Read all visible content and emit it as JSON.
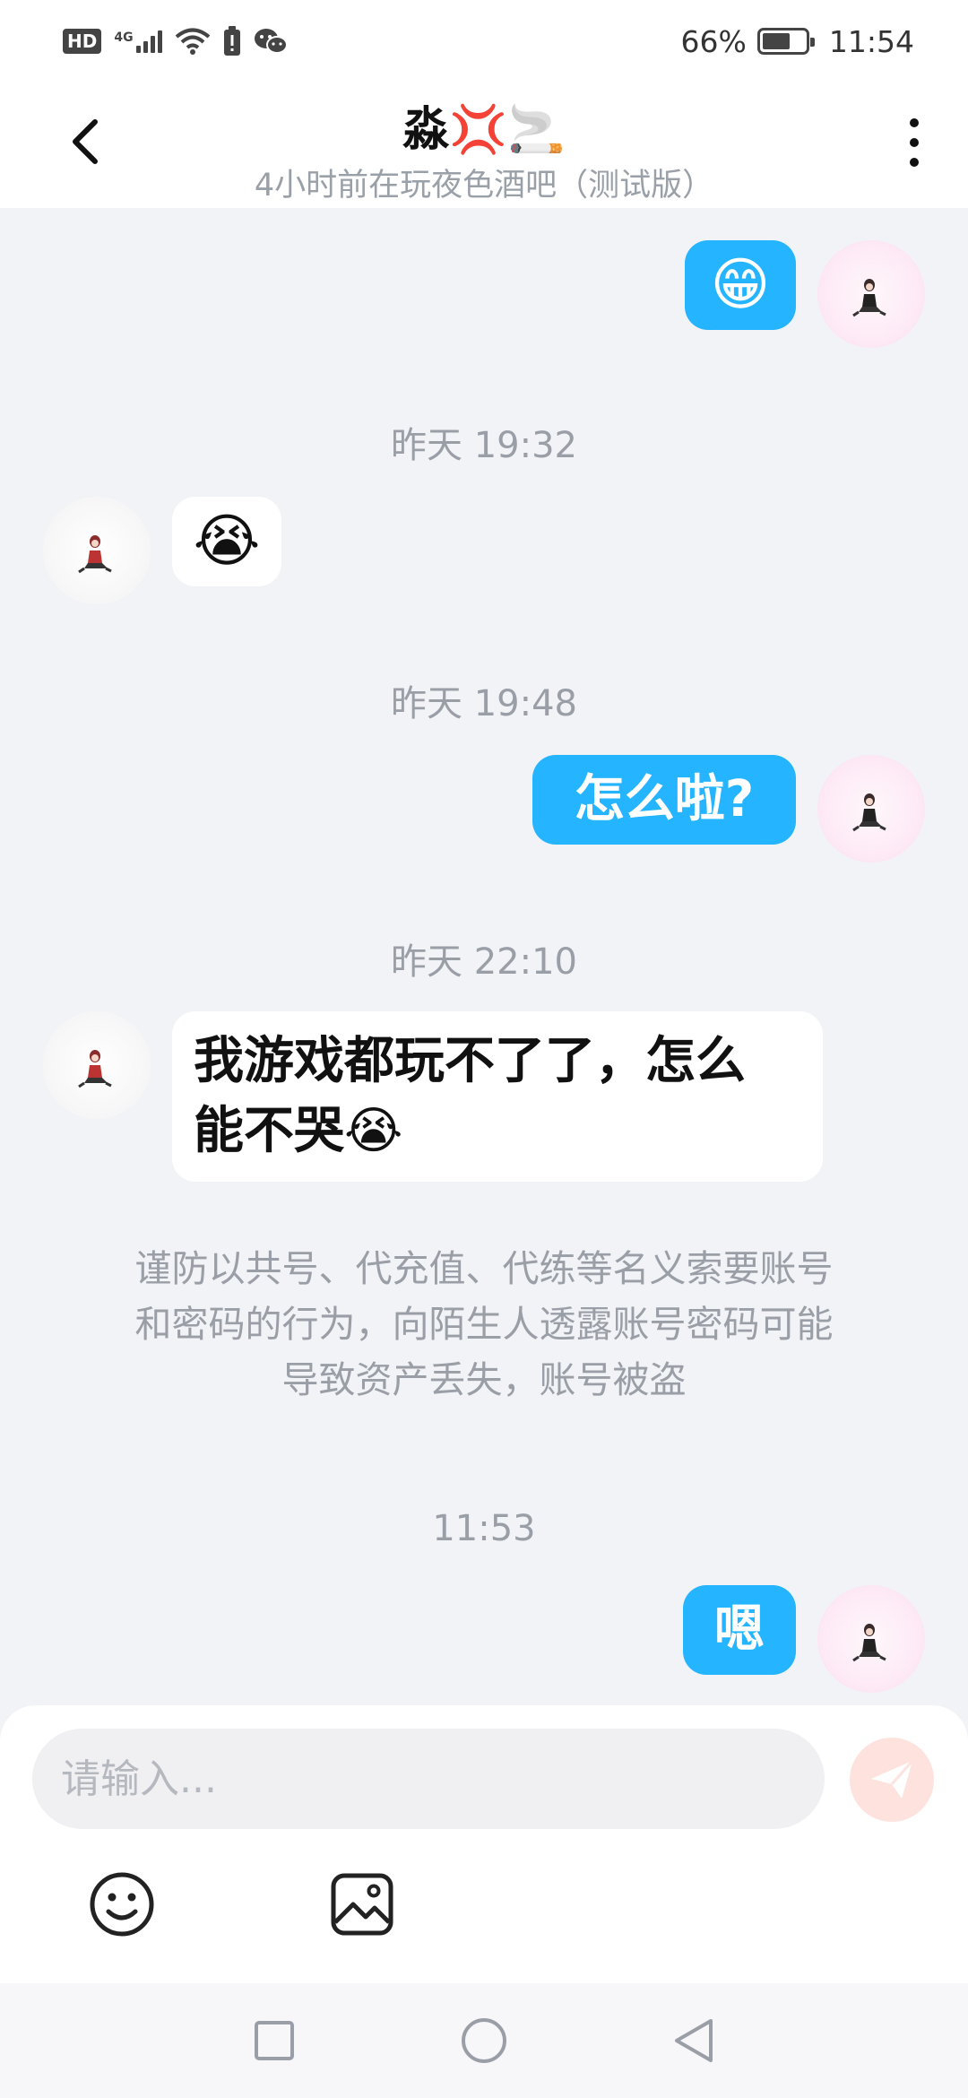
{
  "status_bar": {
    "hd": "HD",
    "network": "4G",
    "battery_percent": "66%",
    "battery_level": 0.66,
    "time": "11:54"
  },
  "header": {
    "title": "淼💢🚬",
    "subtitle": "4小时前在玩夜色酒吧（测试版）",
    "back_icon": "chevron-left-icon",
    "more_icon": "more-vertical-icon"
  },
  "messages": [
    {
      "type": "message",
      "sender": "me",
      "content": "😁"
    },
    {
      "type": "timestamp",
      "text": "昨天 19:32"
    },
    {
      "type": "message",
      "sender": "other",
      "content": "😭"
    },
    {
      "type": "timestamp",
      "text": "昨天 19:48"
    },
    {
      "type": "message",
      "sender": "me",
      "content": "怎么啦?"
    },
    {
      "type": "timestamp",
      "text": "昨天 22:10"
    },
    {
      "type": "message",
      "sender": "other",
      "content_line1": "我游戏都玩不了了，怎么",
      "content_line2": "能不哭😭"
    },
    {
      "type": "notice",
      "line1": "谨防以共号、代充值、代练等名义索要账号",
      "line2": "和密码的行为，向陌生人透露账号密码可能",
      "line3": "导致资产丢失，账号被盗"
    },
    {
      "type": "timestamp",
      "text": "11:53"
    },
    {
      "type": "message",
      "sender": "me",
      "content": "嗯"
    }
  ],
  "input": {
    "placeholder": "请输入...",
    "value": ""
  },
  "toolbar": {
    "emoji_icon": "smiley-icon",
    "image_icon": "image-icon",
    "send_icon": "send-icon"
  },
  "colors": {
    "accent": "#25b4ff",
    "background": "#f2f3f6",
    "send_button": "#fde2dd",
    "send_icon": "#ffffff"
  },
  "nav": {
    "recent_icon": "square-icon",
    "home_icon": "circle-icon",
    "back_icon": "triangle-back-icon"
  }
}
